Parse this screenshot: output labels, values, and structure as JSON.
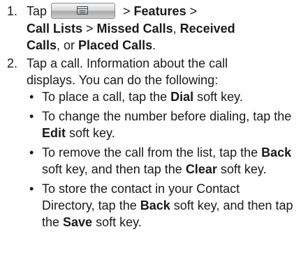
{
  "steps": [
    {
      "number": "1.",
      "tap": "Tap",
      "icon": "menu-key-icon",
      "sep1": " > ",
      "features": "Features",
      "sep2": " >",
      "call_lists": "Call Lists",
      "sep3": " > ",
      "missed": "Missed Calls",
      "comma1": ", ",
      "received": "Received",
      "calls": "Calls",
      "or": ", or ",
      "placed": "Placed Calls",
      "period": "."
    },
    {
      "number": "2.",
      "text_line1": "Tap a call. Information about the call",
      "text_line2": "displays. You can do the following:",
      "bullets": [
        {
          "pre": "To place a call, tap the ",
          "key": "Dial",
          "post": " soft key."
        },
        {
          "pre": "To change the number before dialing, tap the ",
          "key": "Edit",
          "post": " soft key."
        },
        {
          "pre": "To remove the call from the list, tap the ",
          "key": "Back",
          "mid": " soft key, and then tap the ",
          "key2": "Clear",
          "post": " soft key."
        },
        {
          "pre": "To store the contact in your Contact Directory, tap the ",
          "key": "Back",
          "mid": " soft key, and then tap the ",
          "key2": "Save",
          "post": " soft key."
        }
      ]
    }
  ]
}
